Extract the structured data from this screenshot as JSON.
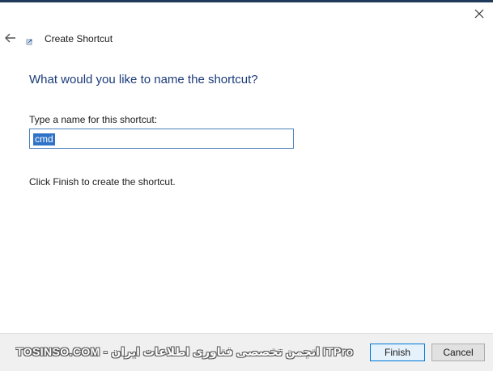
{
  "window": {
    "title": "Create Shortcut"
  },
  "page": {
    "heading": "What would you like to name the shortcut?",
    "field_label": "Type a name for this shortcut:",
    "input_value": "cmd",
    "info_text": "Click Finish to create the shortcut."
  },
  "buttons": {
    "finish": "Finish",
    "cancel": "Cancel"
  },
  "watermark": "TOSINSO.COM - انجمن تخصصی فناوری اطلاعات ایران ITPro",
  "icons": {
    "close": "close-icon",
    "back": "back-arrow-icon",
    "wizard": "shortcut-wizard-icon"
  },
  "colors": {
    "heading": "#1b3a78",
    "selection": "#2f73c8",
    "input_border": "#4a7fbf",
    "footer_bg": "#f0f0f0",
    "primary_border": "#0078d7"
  }
}
